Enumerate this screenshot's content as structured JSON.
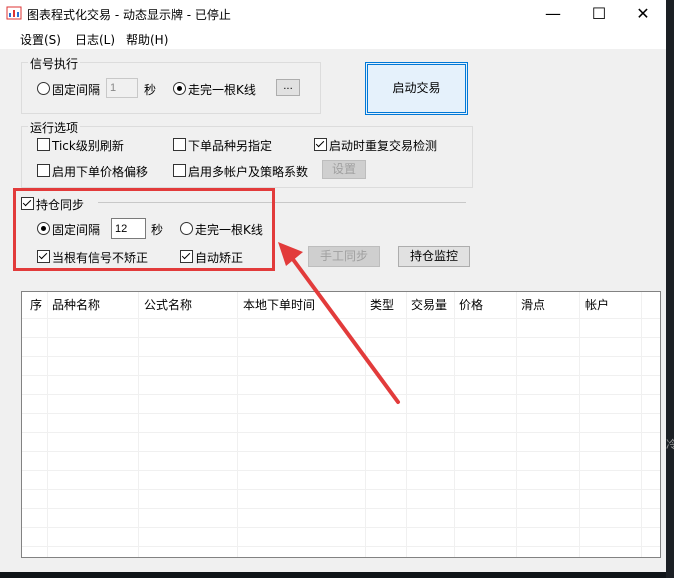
{
  "window": {
    "title": "图表程式化交易 - 动态显示牌 - 已停止"
  },
  "window_controls": {
    "minimize": "—",
    "maximize": "☐",
    "close": "✕"
  },
  "menu": [
    "设置(S)",
    "日志(L)",
    "帮助(H)"
  ],
  "signal_exec": {
    "group_label": "信号执行",
    "fixed_interval_label": "固定间隔",
    "interval_value": "1",
    "unit": "秒",
    "complete_kline_label": "走完一根K线",
    "browse_label": "...",
    "selected": "complete_kline"
  },
  "start_trading_label": "启动交易",
  "run_options": {
    "group_label": "运行选项",
    "tick_refresh": {
      "label": "Tick级别刷新",
      "checked": false
    },
    "order_variety": {
      "label": "下单品种另指定",
      "checked": false
    },
    "restart_check": {
      "label": "启动时重复交易检测",
      "checked": true
    },
    "price_offset": {
      "label": "启用下单价格偏移",
      "checked": false
    },
    "multi_account": {
      "label": "启用多帐户及策略系数",
      "checked": false
    },
    "settings_label": "设置"
  },
  "position_sync": {
    "label": "持仓同步",
    "checked": true,
    "fixed_interval_label": "固定间隔",
    "interval_value": "12",
    "unit": "秒",
    "complete_kline_label": "走完一根K线",
    "selected": "fixed_interval",
    "no_correct_on_signal": {
      "label": "当根有信号不矫正",
      "checked": true
    },
    "auto_correct": {
      "label": "自动矫正",
      "checked": true
    },
    "manual_sync_label": "手工同步",
    "position_monitor_label": "持仓监控"
  },
  "table": {
    "columns": [
      "序",
      "品种名称",
      "公式名称",
      "本地下单时间",
      "类型",
      "交易量",
      "价格",
      "滑点",
      "帐户"
    ],
    "rows": []
  },
  "annotation_color": "#e23b3b"
}
